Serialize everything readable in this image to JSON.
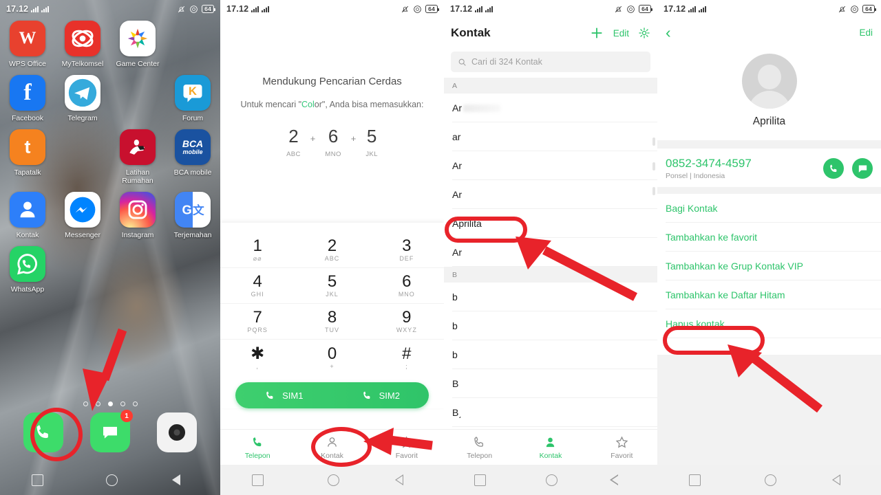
{
  "status_bar": {
    "time": "17.12",
    "battery": "64",
    "icons": [
      "signal-bars",
      "signal-bars",
      "bell-muted-icon",
      "dnd-icon",
      "battery-icon"
    ]
  },
  "home_screen": {
    "apps": [
      {
        "label": "WPS Office",
        "icon": "wps-office-icon"
      },
      {
        "label": "MyTelkomsel",
        "icon": "mytelkomsel-icon"
      },
      {
        "label": "Game Center",
        "icon": "game-center-icon"
      },
      {
        "label": "",
        "icon": "empty-slot"
      },
      {
        "label": "Facebook",
        "icon": "facebook-icon"
      },
      {
        "label": "Telegram",
        "icon": "telegram-icon"
      },
      {
        "label": "",
        "icon": "empty-slot"
      },
      {
        "label": "Forum",
        "icon": "forum-icon"
      },
      {
        "label": "Tapatalk",
        "icon": "tapatalk-icon"
      },
      {
        "label": "",
        "icon": "empty-slot"
      },
      {
        "label": "Latihan Rumahan",
        "icon": "latihan-rumahan-icon"
      },
      {
        "label": "BCA mobile",
        "icon": "bca-mobile-icon"
      },
      {
        "label": "Kontak",
        "icon": "kontak-icon"
      },
      {
        "label": "Messenger",
        "icon": "messenger-icon"
      },
      {
        "label": "Instagram",
        "icon": "instagram-icon"
      },
      {
        "label": "Terjemahan",
        "icon": "google-translate-icon"
      },
      {
        "label": "WhatsApp",
        "icon": "whatsapp-icon"
      },
      {
        "label": "",
        "icon": "empty-slot"
      },
      {
        "label": "",
        "icon": "empty-slot"
      },
      {
        "label": "",
        "icon": "empty-slot"
      }
    ],
    "page_dots": {
      "count": 5,
      "active_index": 2
    },
    "dock": [
      {
        "name": "phone-app",
        "icon": "phone-icon",
        "badge": ""
      },
      {
        "name": "messages-app",
        "icon": "message-icon",
        "badge": "1"
      },
      {
        "name": "camera-app",
        "icon": "camera-icon",
        "badge": ""
      }
    ]
  },
  "dialer": {
    "hint_title": "Mendukung Pencarian Cerdas",
    "hint_sub_pre": "Untuk mencari \"",
    "hint_sub_hl": "Col",
    "hint_sub_mid": "or\", Anda bisa memasukkan:",
    "equation": [
      {
        "digit": "2",
        "letters": "ABC"
      },
      {
        "digit": "6",
        "letters": "MNO"
      },
      {
        "digit": "5",
        "letters": "JKL"
      }
    ],
    "plus": "+",
    "keys": [
      {
        "digit": "1",
        "letters": "⌀⌀"
      },
      {
        "digit": "2",
        "letters": "ABC"
      },
      {
        "digit": "3",
        "letters": "DEF"
      },
      {
        "digit": "4",
        "letters": "GHI"
      },
      {
        "digit": "5",
        "letters": "JKL"
      },
      {
        "digit": "6",
        "letters": "MNO"
      },
      {
        "digit": "7",
        "letters": "PQRS"
      },
      {
        "digit": "8",
        "letters": "TUV"
      },
      {
        "digit": "9",
        "letters": "WXYZ"
      },
      {
        "digit": "✱",
        "letters": ","
      },
      {
        "digit": "0",
        "letters": "+"
      },
      {
        "digit": "#",
        "letters": ";"
      }
    ],
    "sim_buttons": [
      {
        "label": "SIM1",
        "icon": "phone-sim1-icon"
      },
      {
        "label": "SIM2",
        "icon": "phone-sim2-icon"
      }
    ],
    "tabs": [
      {
        "label": "Telepon",
        "icon": "phone-icon",
        "active": true
      },
      {
        "label": "Kontak",
        "icon": "contact-icon",
        "active": false
      },
      {
        "label": "Favorit",
        "icon": "star-icon",
        "active": false
      }
    ]
  },
  "contacts": {
    "title": "Kontak",
    "actions": [
      {
        "label": "+",
        "name": "add-contact-button"
      },
      {
        "label": "Edit",
        "name": "edit-button"
      },
      {
        "label": "",
        "name": "settings-gear-icon"
      }
    ],
    "search_placeholder": "Cari di 324 Kontak",
    "sections": [
      {
        "letter": "A",
        "rows": [
          {
            "text": "Ar",
            "redacted": true,
            "redact_w": 54,
            "highlight": false
          },
          {
            "text": "ar",
            "redacted": false,
            "redact_w": 0,
            "highlight": false
          },
          {
            "text": "Ar",
            "redacted": false,
            "redact_w": 0,
            "highlight": false
          },
          {
            "text": "Ar",
            "redacted": false,
            "redact_w": 0,
            "highlight": false
          },
          {
            "text": "Aprilita",
            "redacted": false,
            "redact_w": 0,
            "highlight": true
          },
          {
            "text": "Ar",
            "redacted": false,
            "redact_w": 0,
            "highlight": false
          }
        ]
      },
      {
        "letter": "B",
        "rows": [
          {
            "text": "b",
            "redacted": false,
            "redact_w": 0,
            "highlight": false
          },
          {
            "text": "b",
            "redacted": false,
            "redact_w": 0,
            "highlight": false
          },
          {
            "text": "b",
            "redacted": false,
            "redact_w": 0,
            "highlight": false
          },
          {
            "text": "B",
            "redacted": false,
            "redact_w": 0,
            "highlight": false
          },
          {
            "text": "B͵",
            "redacted": false,
            "redact_w": 0,
            "highlight": false
          }
        ]
      }
    ],
    "tabs": [
      {
        "label": "Telepon",
        "icon": "phone-icon",
        "active": false
      },
      {
        "label": "Kontak",
        "icon": "contact-icon",
        "active": true
      },
      {
        "label": "Favorit",
        "icon": "star-icon",
        "active": false
      }
    ]
  },
  "contact_detail": {
    "back_label": "‹",
    "edit_label": "Edi",
    "avatar": "default-person-avatar",
    "name": "Aprilita",
    "phone_number": "0852-3474-4597",
    "phone_type": "Ponsel | Indonesia",
    "call_buttons": [
      {
        "name": "call-button",
        "icon": "phone-icon"
      },
      {
        "name": "message-button",
        "icon": "chat-icon"
      }
    ],
    "options": [
      {
        "label": "Bagi Kontak",
        "name": "share-contact-option",
        "highlight": false
      },
      {
        "label": "Tambahkan ke favorit",
        "name": "add-favorite-option",
        "highlight": false
      },
      {
        "label": "Tambahkan ke Grup Kontak VIP",
        "name": "add-vip-group-option",
        "highlight": false
      },
      {
        "label": "Tambahkan ke Daftar Hitam",
        "name": "add-blacklist-option",
        "highlight": false
      },
      {
        "label": "Hapus kontak",
        "name": "delete-contact-option",
        "highlight": true
      }
    ]
  },
  "annotations": {
    "color": "#e8232a",
    "marks": [
      {
        "type": "ellipse",
        "target": "phone-app-dock-icon"
      },
      {
        "type": "arrow",
        "target": "phone-app-dock-icon"
      },
      {
        "type": "ellipse",
        "target": "kontak-tab"
      },
      {
        "type": "arrow",
        "target": "kontak-tab"
      },
      {
        "type": "ellipse",
        "target": "aprilita-contact-row"
      },
      {
        "type": "arrow",
        "target": "aprilita-contact-row"
      },
      {
        "type": "ellipse",
        "target": "delete-contact-option"
      },
      {
        "type": "arrow",
        "target": "delete-contact-option"
      }
    ]
  }
}
